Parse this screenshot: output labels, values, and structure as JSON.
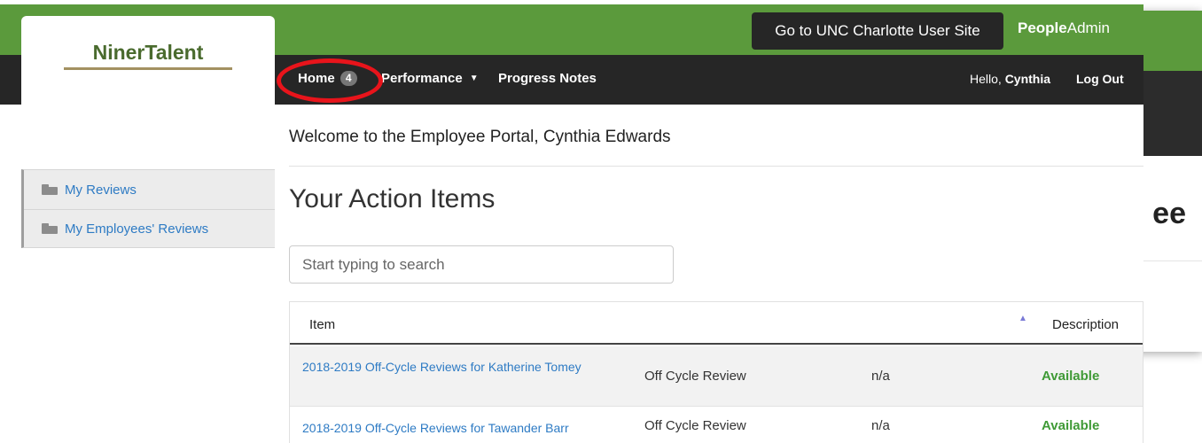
{
  "logo": {
    "text": "NinerTalent"
  },
  "topbar": {
    "user_site_button": "Go to UNC Charlotte User Site",
    "brand_bold": "People",
    "brand_rest": "Admin"
  },
  "nav": {
    "home_label": "Home",
    "home_badge": "4",
    "performance_label": "Performance",
    "progress_notes_label": "Progress Notes",
    "hello_prefix": "Hello,",
    "user_name": "Cynthia",
    "logout_label": "Log Out"
  },
  "sidebar": {
    "items": [
      {
        "label": "My Reviews",
        "icon": "folder-open-icon"
      },
      {
        "label": "My Employees' Reviews",
        "icon": "folder-open-icon"
      }
    ]
  },
  "main": {
    "welcome": "Welcome to the Employee Portal, Cynthia Edwards",
    "section_title": "Your Action Items",
    "search_placeholder": "Start typing to search",
    "table": {
      "headers": {
        "item": "Item",
        "description": "Description"
      },
      "rows": [
        {
          "item": "2018-2019 Off-Cycle Reviews for Katherine Tomey",
          "type": "Off Cycle Review",
          "extra": "n/a",
          "status": "Available"
        },
        {
          "item": "2018-2019 Off-Cycle Reviews for Tawander Barr",
          "type": "Off Cycle Review",
          "extra": "n/a",
          "status": "Available"
        }
      ]
    }
  },
  "background_window": {
    "partial_text": "ee"
  },
  "colors": {
    "green": "#5b9a3c",
    "dark": "#262626",
    "link": "#2e7bc4",
    "available": "#3f9a36",
    "highlight": "#e8141b"
  }
}
